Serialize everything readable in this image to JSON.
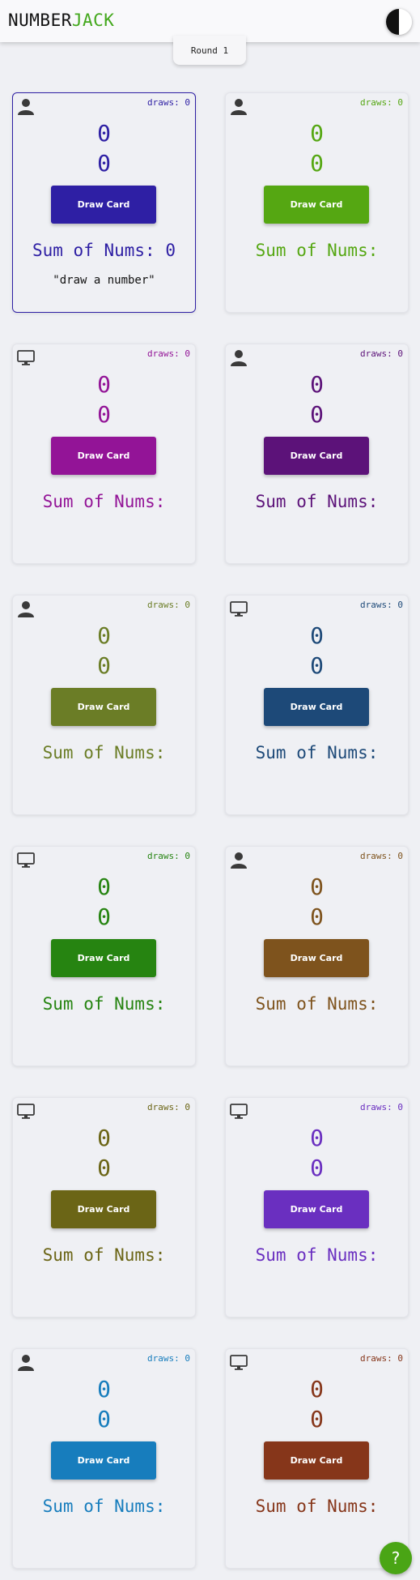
{
  "header": {
    "logo_part1": "NUMBER",
    "logo_part2": "JACK",
    "logo_accent_color": "#43a81c",
    "theme_toggle_icon": "half-moon-icon"
  },
  "round": {
    "label": "Round 1"
  },
  "help": {
    "label": "?",
    "color": "#4aa515"
  },
  "players": [
    {
      "type": "human",
      "icon": "person-icon",
      "color": "#2e1fa4",
      "draws_label": "draws: 0",
      "card1": "0",
      "card2": "0",
      "button_label": "Draw Card",
      "sum_label": "Sum of Nums: 0",
      "hint": "\"draw a number\"",
      "active": true
    },
    {
      "type": "human",
      "icon": "person-icon",
      "color": "#55a712",
      "draws_label": "draws: 0",
      "card1": "0",
      "card2": "0",
      "button_label": "Draw Card",
      "sum_label": "Sum of Nums:"
    },
    {
      "type": "computer",
      "icon": "monitor-icon",
      "color": "#931497",
      "draws_label": "draws: 0",
      "card1": "0",
      "card2": "0",
      "button_label": "Draw Card",
      "sum_label": "Sum of Nums:"
    },
    {
      "type": "human",
      "icon": "person-icon",
      "color": "#5c1279",
      "draws_label": "draws: 0",
      "card1": "0",
      "card2": "0",
      "button_label": "Draw Card",
      "sum_label": "Sum of Nums:"
    },
    {
      "type": "human",
      "icon": "person-icon",
      "color": "#6b7d26",
      "draws_label": "draws: 0",
      "card1": "0",
      "card2": "0",
      "button_label": "Draw Card",
      "sum_label": "Sum of Nums:"
    },
    {
      "type": "computer",
      "icon": "monitor-icon",
      "color": "#1d4978",
      "draws_label": "draws: 0",
      "card1": "0",
      "card2": "0",
      "button_label": "Draw Card",
      "sum_label": "Sum of Nums:"
    },
    {
      "type": "computer",
      "icon": "monitor-icon",
      "color": "#268411",
      "draws_label": "draws: 0",
      "card1": "0",
      "card2": "0",
      "button_label": "Draw Card",
      "sum_label": "Sum of Nums:"
    },
    {
      "type": "human",
      "icon": "person-icon",
      "color": "#7e531d",
      "draws_label": "draws: 0",
      "card1": "0",
      "card2": "0",
      "button_label": "Draw Card",
      "sum_label": "Sum of Nums:"
    },
    {
      "type": "computer",
      "icon": "monitor-icon",
      "color": "#6b6516",
      "draws_label": "draws: 0",
      "card1": "0",
      "card2": "0",
      "button_label": "Draw Card",
      "sum_label": "Sum of Nums:"
    },
    {
      "type": "computer",
      "icon": "monitor-icon",
      "color": "#6a2fc0",
      "draws_label": "draws: 0",
      "card1": "0",
      "card2": "0",
      "button_label": "Draw Card",
      "sum_label": "Sum of Nums:"
    },
    {
      "type": "human",
      "icon": "person-icon",
      "color": "#177dbd",
      "draws_label": "draws: 0",
      "card1": "0",
      "card2": "0",
      "button_label": "Draw Card",
      "sum_label": "Sum of Nums:"
    },
    {
      "type": "computer",
      "icon": "monitor-icon",
      "color": "#86361a",
      "draws_label": "draws: 0",
      "card1": "0",
      "card2": "0",
      "button_label": "Draw Card",
      "sum_label": "Sum of Nums:"
    }
  ]
}
